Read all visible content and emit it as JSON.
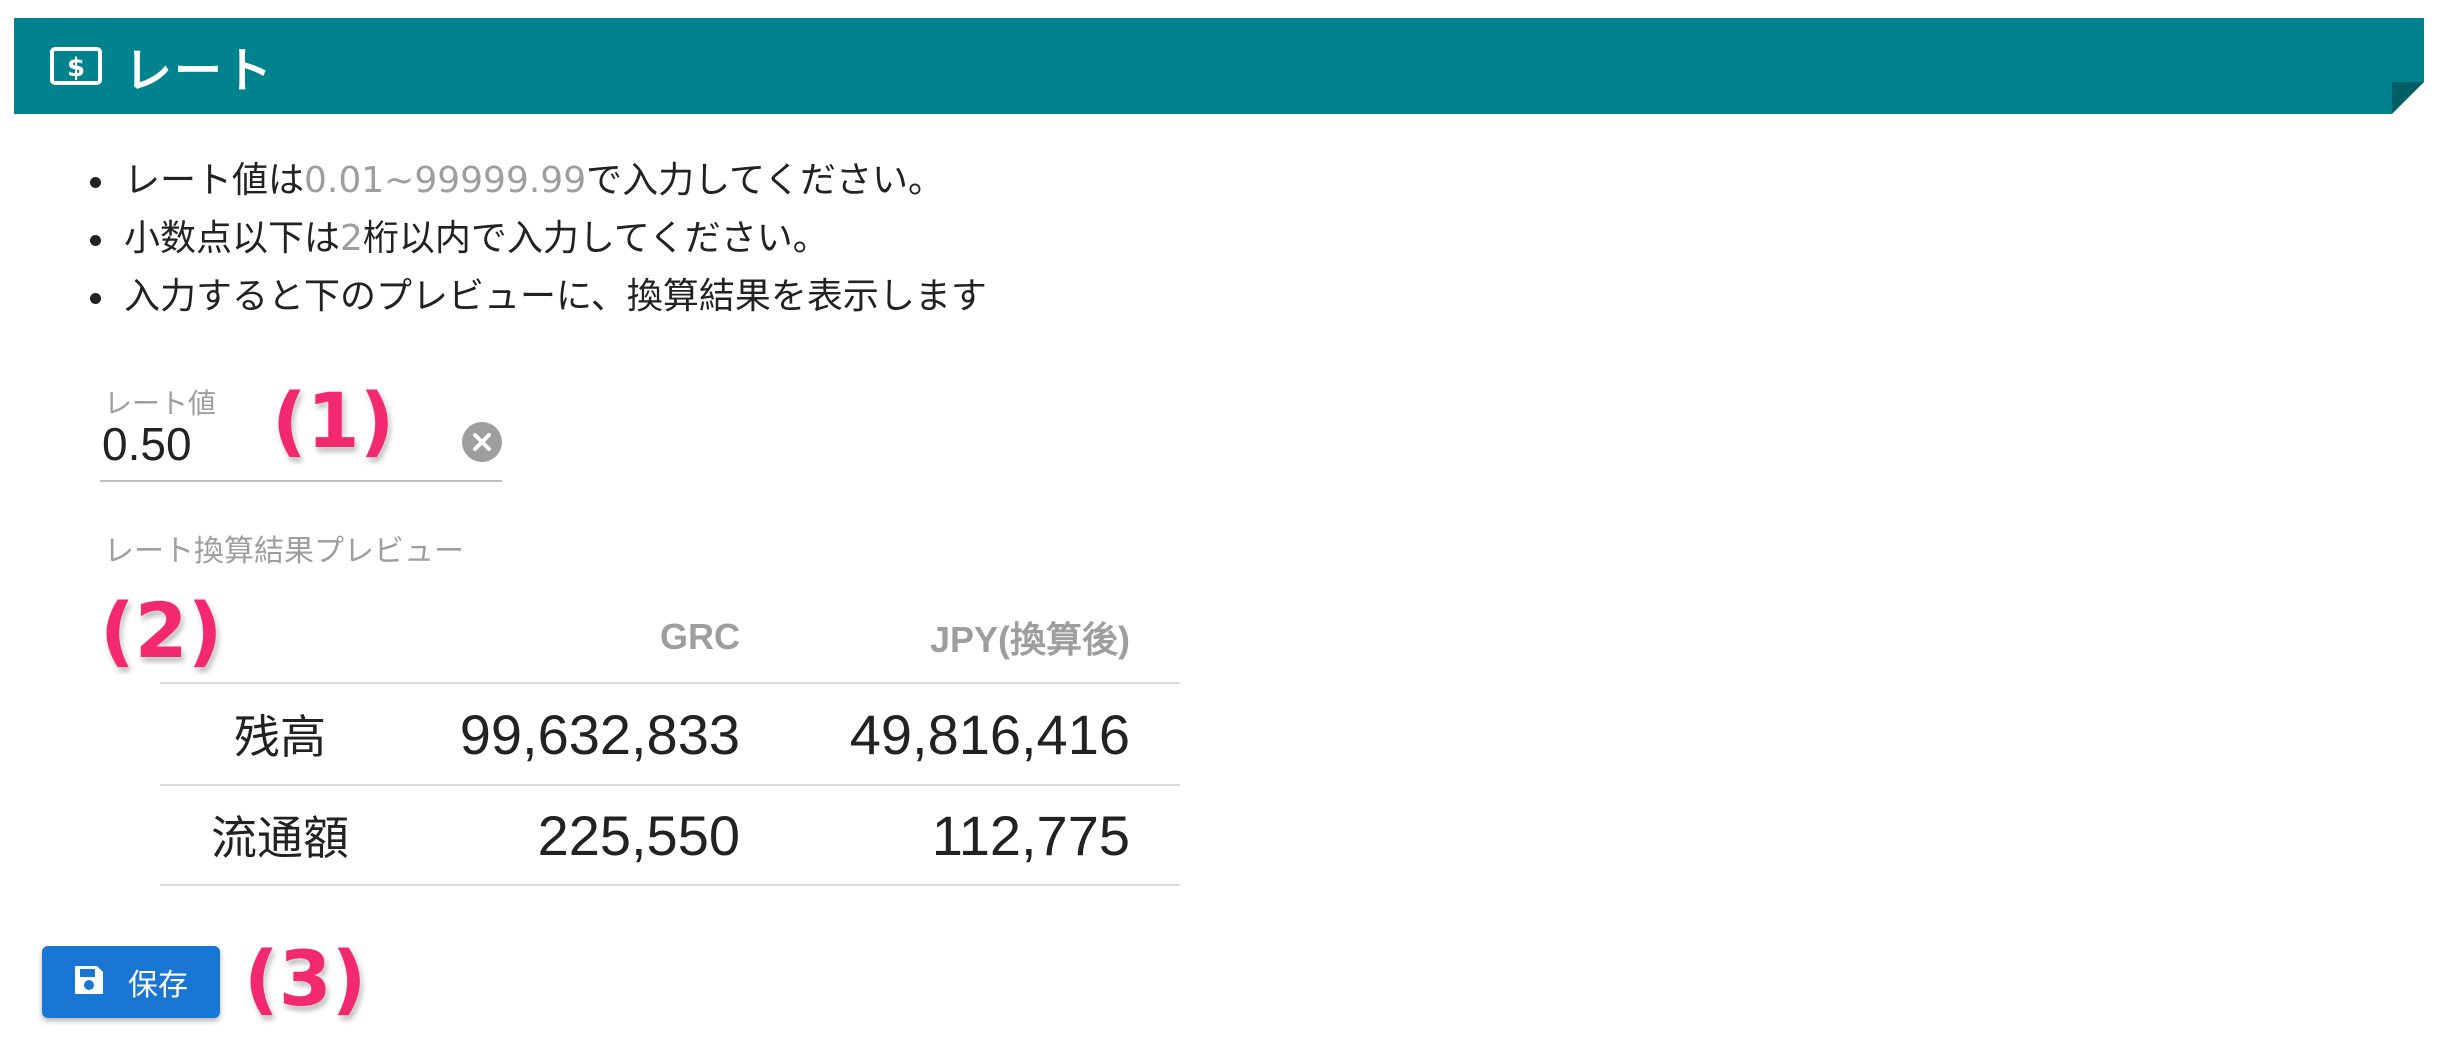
{
  "header": {
    "title": "レート",
    "icon": "dollar-bill-icon",
    "color": "#00838f"
  },
  "notes": {
    "item1": {
      "before": "レート値は",
      "range": "0.01~99999.99",
      "after": "で入力してください。"
    },
    "item2": {
      "before": "小数点以下は",
      "digits": "2",
      "after": "桁以内で入力してください。"
    },
    "item3": {
      "text": "入力すると下のプレビューに、換算結果を表示します"
    }
  },
  "rate_field": {
    "label": "レート値",
    "value": "0.50",
    "clear_icon": "clear-circle-icon"
  },
  "preview": {
    "label": "レート換算結果プレビュー",
    "columns": [
      "",
      "GRC",
      "JPY(換算後)"
    ],
    "rows": [
      {
        "label": "残高",
        "grc": "99,632,833",
        "jpy": "49,816,416"
      },
      {
        "label": "流通額",
        "grc": "225,550",
        "jpy": "112,775"
      }
    ]
  },
  "save_button": {
    "label": "保存",
    "icon": "save-icon",
    "color": "#1976d2"
  },
  "markers": {
    "m1": "(1)",
    "m2": "(2)",
    "m3": "(3)",
    "color": "#f2296e"
  }
}
